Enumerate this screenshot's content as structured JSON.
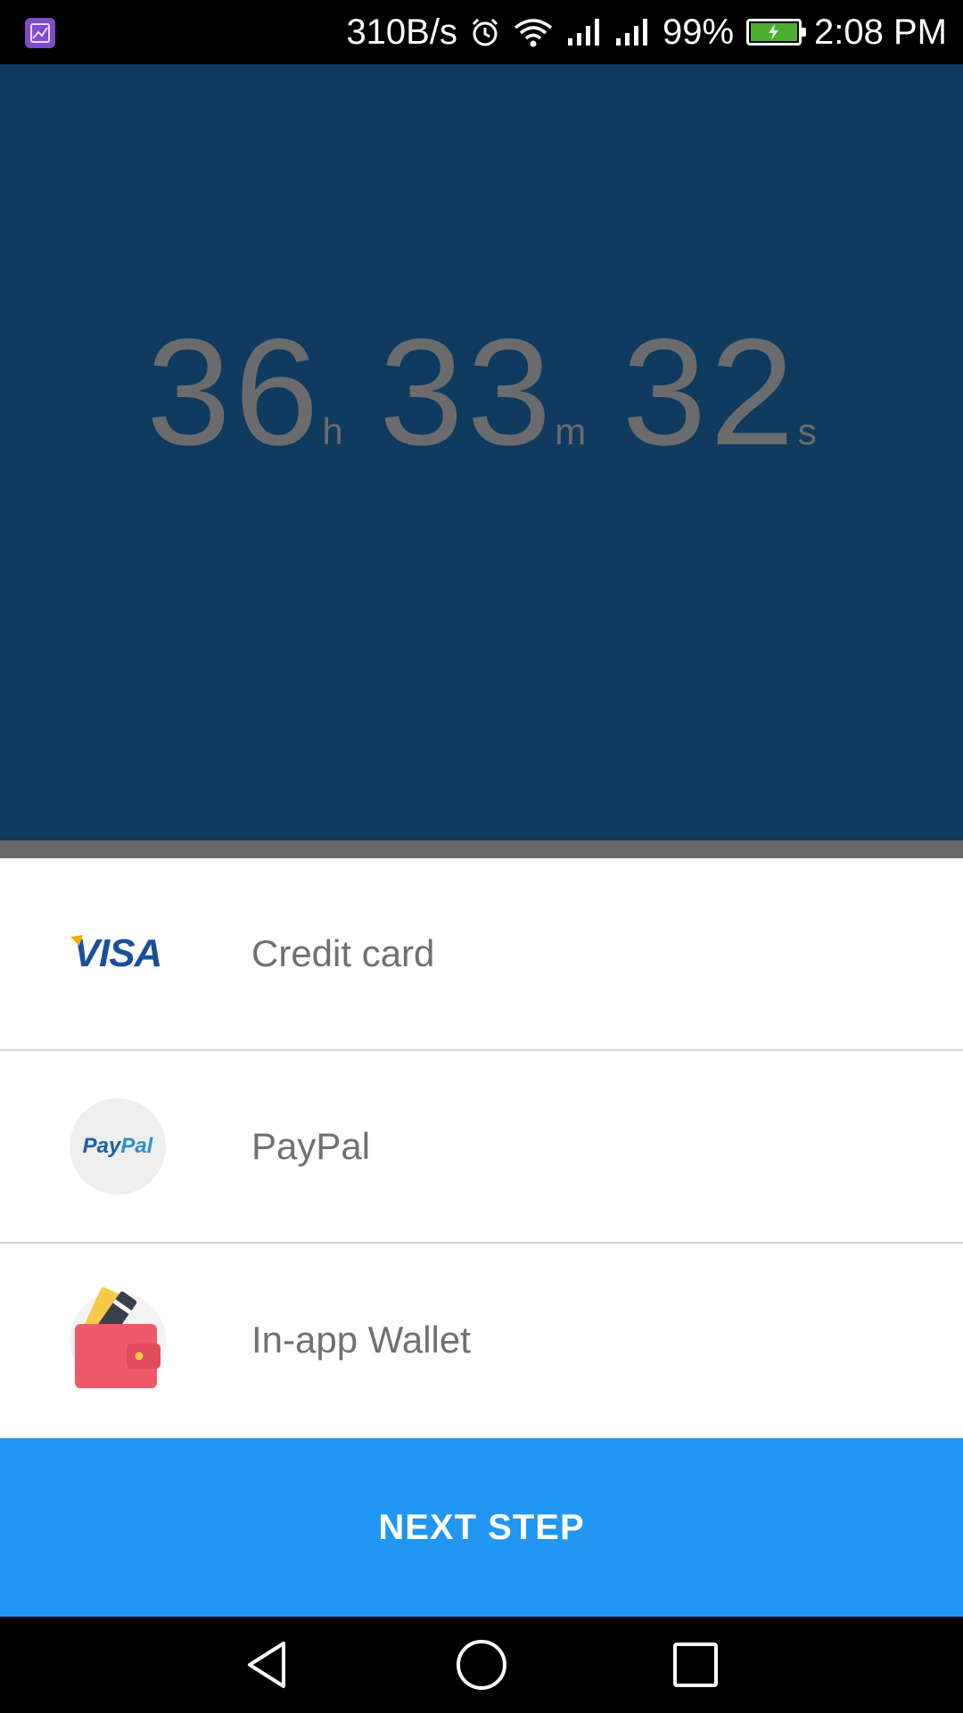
{
  "status_bar": {
    "network_speed": "310B/s",
    "battery_percent": "99%",
    "battery_level": 0.99,
    "time": "2:08 PM",
    "icons": [
      "gallery-app-icon",
      "alarm-icon",
      "wifi-icon",
      "signal-icon",
      "signal-icon",
      "battery-charging-icon"
    ]
  },
  "countdown": {
    "hours": "36",
    "hours_unit": "h",
    "minutes": "33",
    "minutes_unit": "m",
    "seconds": "32",
    "seconds_unit": "s"
  },
  "payment_methods": [
    {
      "label": "Credit card",
      "icon": "visa-logo-icon",
      "logo_text": "VISA"
    },
    {
      "label": "PayPal",
      "icon": "paypal-logo-icon",
      "logo_text_1": "Pay",
      "logo_text_2": "Pal"
    },
    {
      "label": "In-app Wallet",
      "icon": "wallet-icon"
    }
  ],
  "next_button": {
    "label": "NEXT STEP"
  },
  "colors": {
    "hero_bg": "#0e3b5f",
    "button_bg": "#2196f3",
    "countdown_text": "#6b6b6b"
  },
  "nav_bar": {
    "icons": [
      "back-icon",
      "home-icon",
      "recents-icon"
    ]
  }
}
